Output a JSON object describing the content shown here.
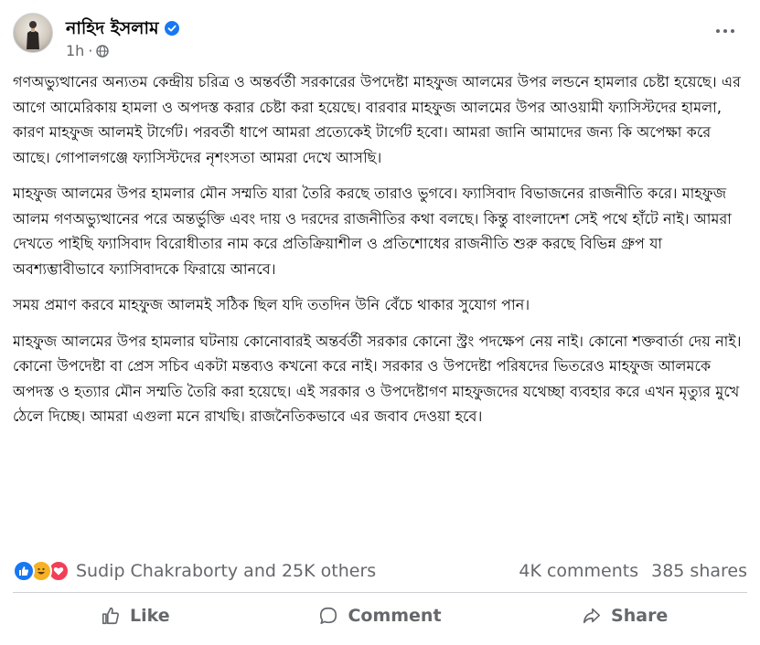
{
  "post": {
    "author": {
      "name": "নাহিদ ইসলাম",
      "verified": true,
      "avatar_icon": "profile-photo"
    },
    "timestamp": "1h",
    "audience_icon": "globe-icon",
    "more_icon": "more-options-icon",
    "paragraphs": [
      "গণঅভ্যুত্থানের অন্যতম কেন্দ্রীয় চরিত্র ও অন্তর্বর্তী সরকারের উপদেষ্টা মাহফুজ আলমের উপর লন্ডনে হামলার চেষ্টা হয়েছে। এর আগে আমেরিকায় হামলা ও অপদস্ত করার চেষ্টা করা হয়েছে। বারবার মাহফুজ আলমের উপর আওয়ামী ফ্যাসিস্টদের হামলা, কারণ মাহফুজ আলমই টার্গেট। পরবর্তী ধাপে আমরা প্রত্যেকেই টার্গেট হবো। আমরা জানি আমাদের জন্য কি অপেক্ষা করে আছে। গোপালগঞ্জে ফ্যাসিস্টদের নৃশংসতা আমরা দেখে আসছি।",
      "মাহফুজ আলমের উপর হামলার মৌন সম্মতি যারা তৈরি করছে তারাও ভুগবে। ফ্যাসিবাদ বিভাজনের রাজনীতি করে। মাহফুজ আলম গণঅভ্যুত্থানের পরে অন্তর্ভুক্তি এবং দায় ও দরদের রাজনীতির কথা বলছে। কিন্তু বাংলাদেশ সেই পথে হাঁটে নাই। আমরা দেখতে পাইছি ফ্যাসিবাদ বিরোধীতার নাম করে প্রতিক্রিয়াশীল ও প্রতিশোধের রাজনীতি শুরু করছে বিভিন্ন গ্রুপ যা অবশ্যম্ভাবীভাবে ফ্যাসিবাদকে ফিরায়ে আনবে।",
      "সময় প্রমাণ করবে মাহফুজ আলমই সঠিক ছিল যদি ততদিন উনি বেঁচে থাকার সুযোগ পান।",
      "মাহফুজ আলমের উপর হামলার ঘটনায় কোনোবারই অন্তর্বর্তী সরকার কোনো স্ট্রং পদক্ষেপ নেয় নাই। কোনো শক্তবার্তা দেয় নাই। কোনো উপদেষ্টা বা প্রেস সচিব একটা মন্তব্যও কখনো করে নাই। সরকার ও উপদেষ্টা পরিষদের ভিতরেও মাহফুজ আলমকে অপদস্ত ও হত্যার মৌন সম্মতি তৈরি করা হয়েছে। এই সরকার ও উপদেষ্টাগণ মাহফুজদের যথেচ্ছা ব্যবহার করে এখন মৃত্যুর মুখে ঠেলে দিচ্ছে। আমরা এগুলা মনে রাখছি। রাজনৈতিকভাবে এর জবাব দেওয়া হবে।"
    ]
  },
  "reactions": {
    "icons": [
      "like-reaction-icon",
      "haha-reaction-icon",
      "love-reaction-icon"
    ],
    "summary": "Sudip Chakraborty and 25K others",
    "comments": "4K comments",
    "shares": "385 shares"
  },
  "actions": {
    "like_label": "Like",
    "comment_label": "Comment",
    "share_label": "Share"
  },
  "colors": {
    "text_primary": "#050505",
    "text_secondary": "#65676b",
    "verified_blue": "#1877f2",
    "love_red": "#f33e58",
    "haha_yellow": "#f7b125"
  }
}
